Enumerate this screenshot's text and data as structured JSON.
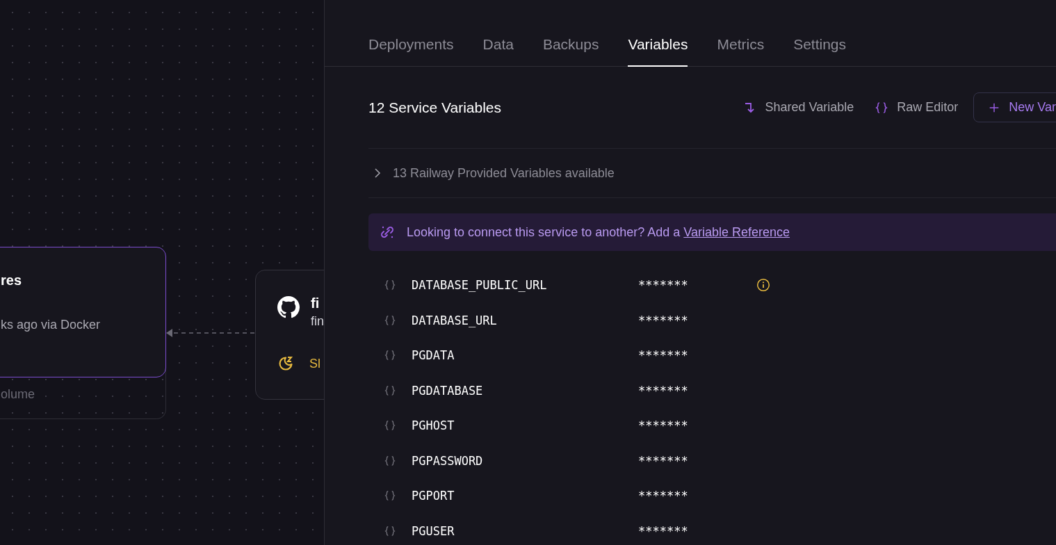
{
  "canvas": {
    "nodes": [
      {
        "kind": "database",
        "title": "res",
        "subtitle": "ks ago via Docker",
        "footer": "olume",
        "selected": true
      },
      {
        "kind": "repo",
        "title": "fi",
        "subtitle": "fin",
        "status": "Sl",
        "selected": false
      }
    ]
  },
  "panel": {
    "tabs": [
      {
        "label": "Deployments",
        "selected": false
      },
      {
        "label": "Data",
        "selected": false
      },
      {
        "label": "Backups",
        "selected": false
      },
      {
        "label": "Variables",
        "selected": true
      },
      {
        "label": "Metrics",
        "selected": false
      },
      {
        "label": "Settings",
        "selected": false
      }
    ],
    "heading": "12 Service Variables",
    "actions": [
      {
        "kind": "shared",
        "label": "Shared Variable"
      },
      {
        "kind": "raw",
        "label": "Raw Editor"
      },
      {
        "kind": "new",
        "label": "New Var"
      }
    ],
    "provided": {
      "label": "13 Railway Provided Variables available",
      "expanded": false
    },
    "banner": {
      "text": "Looking to connect this service to another? Add a",
      "link": "Variable Reference"
    },
    "variables": [
      {
        "name": "DATABASE_PUBLIC_URL",
        "value": "*******",
        "info": true
      },
      {
        "name": "DATABASE_URL",
        "value": "*******",
        "info": false
      },
      {
        "name": "PGDATA",
        "value": "*******",
        "info": false
      },
      {
        "name": "PGDATABASE",
        "value": "*******",
        "info": false
      },
      {
        "name": "PGHOST",
        "value": "*******",
        "info": false
      },
      {
        "name": "PGPASSWORD",
        "value": "*******",
        "info": false
      },
      {
        "name": "PGPORT",
        "value": "*******",
        "info": false
      },
      {
        "name": "PGUSER",
        "value": "*******",
        "info": false
      }
    ]
  }
}
